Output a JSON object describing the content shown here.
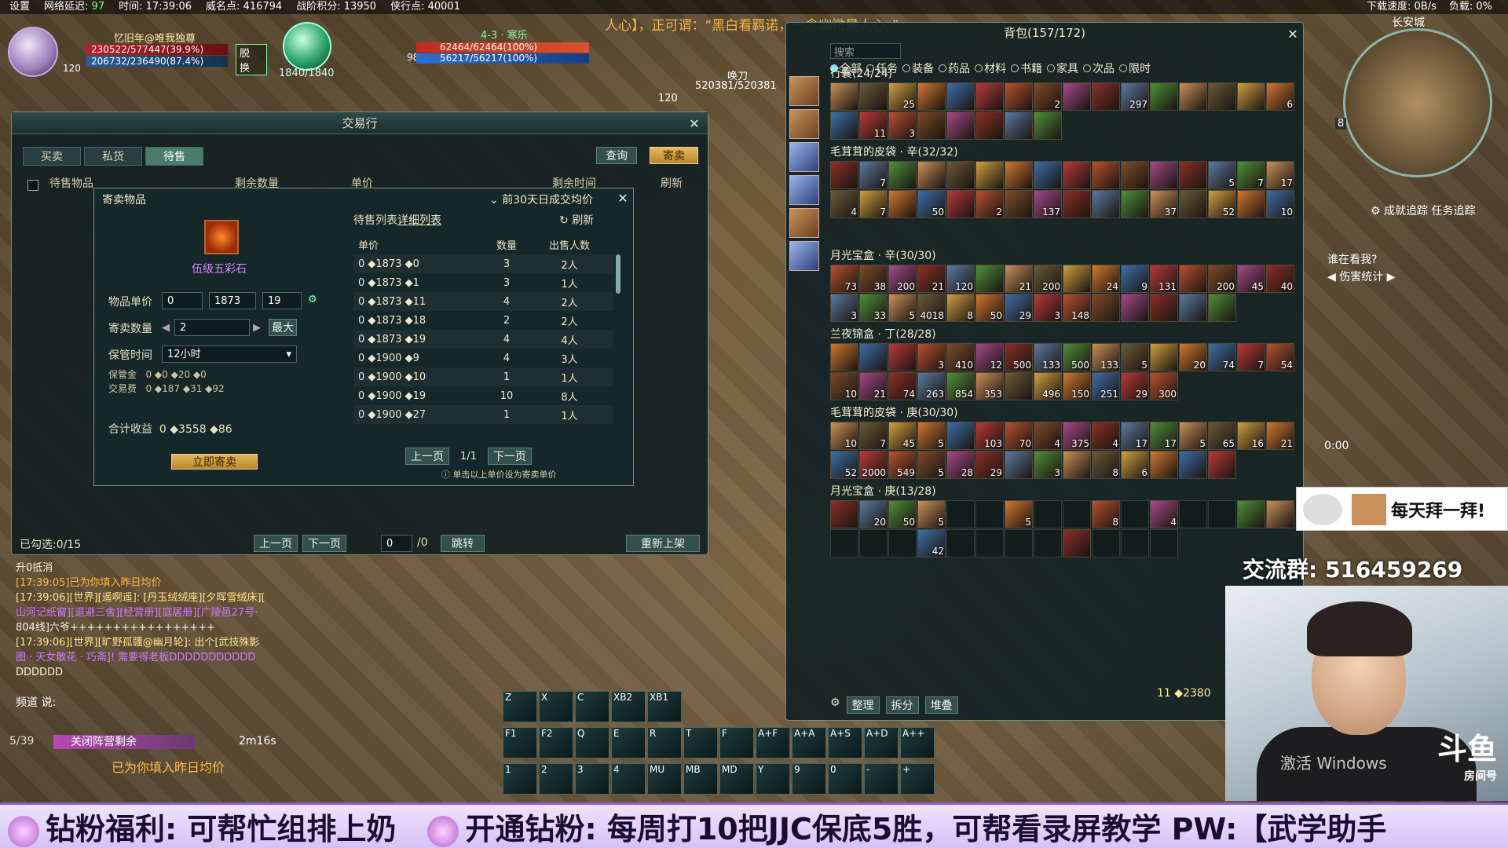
{
  "topbar": {
    "settings": "设置",
    "latency_label": "网络延迟:",
    "latency": "97",
    "time_label": "时间:",
    "time": "17:39:06",
    "fame_label": "威名点:",
    "fame": "416794",
    "war_label": "战阶积分:",
    "war": "13950",
    "merchant_label": "侠行点:",
    "merchant": "40001",
    "download_label": "下载速度:",
    "download": "0B/s",
    "load_label": "负载:",
    "load": "0%"
  },
  "scroll_quote": "人心】，正可谓：“黑白看羁诺，一念幽微是人心。”",
  "player": {
    "name": "忆旧年@唯我独尊",
    "level": "120",
    "hp": "230522/577447(39.9%)",
    "mp": "206732/236490(87.4%)",
    "disengage": "脱 换",
    "orb_value": "1840/1840"
  },
  "target": {
    "name": "4-3 · 寒乐",
    "level": "98",
    "hp": "62464/62464(100%)",
    "mp": "56217/56217(100%)"
  },
  "npc": {
    "name": "唤刀",
    "level": "120",
    "value": "520381/520381"
  },
  "trade": {
    "title": "交易行",
    "tabs": [
      "买卖",
      "私货",
      "待售"
    ],
    "query": "查询",
    "consign": "寄卖",
    "header": {
      "item": "待售物品",
      "remaining": "剩余数量",
      "price": "单价",
      "time_left": "剩余时间",
      "refresh": "刷新"
    },
    "selected": "已勾选:0/15",
    "prev": "上一页",
    "next": "下一页",
    "page_input": "0",
    "page_total": "/0",
    "jump": "跳转",
    "relist": "重新上架"
  },
  "consign": {
    "title": "寄卖物品",
    "avg_link": "前30天日成交均价",
    "item_name": "伍级五彩石",
    "unit_price_label": "物品单价",
    "price_gold": "0",
    "price_silver": "1873",
    "price_copper": "19",
    "qty_label": "寄卖数量",
    "qty": "2",
    "max": "最大",
    "keep_label": "保管时间",
    "keep": "12小时",
    "deposit_label": "保管金",
    "deposit": "0 ◆0 ◆20 ◆0",
    "fee_label": "交易费",
    "fee": "0 ◆187 ◆31 ◆92",
    "total_label": "合计收益",
    "total": "0 ◆3558 ◆86",
    "submit": "立即寄卖",
    "pending_title": "待售列表",
    "pending_link": "详细列表",
    "pending_refresh": "刷新",
    "cols": [
      "单价",
      "数量",
      "出售人数"
    ],
    "rows": [
      {
        "price": "0 ◆1873 ◆0",
        "qty": "3",
        "sellers": "2人"
      },
      {
        "price": "0 ◆1873 ◆1",
        "qty": "3",
        "sellers": "1人"
      },
      {
        "price": "0 ◆1873 ◆11",
        "qty": "4",
        "sellers": "2人"
      },
      {
        "price": "0 ◆1873 ◆18",
        "qty": "2",
        "sellers": "2人"
      },
      {
        "price": "0 ◆1873 ◆19",
        "qty": "4",
        "sellers": "4人"
      },
      {
        "price": "0 ◆1900 ◆9",
        "qty": "4",
        "sellers": "3人"
      },
      {
        "price": "0 ◆1900 ◆10",
        "qty": "1",
        "sellers": "1人"
      },
      {
        "price": "0 ◆1900 ◆19",
        "qty": "10",
        "sellers": "8人"
      },
      {
        "price": "0 ◆1900 ◆27",
        "qty": "1",
        "sellers": "1人"
      }
    ],
    "prev": "上一页",
    "page": "1/1",
    "next": "下一页",
    "hint": "单击以上单价设为寄卖单价"
  },
  "chat": {
    "lines": [
      {
        "cls": "line",
        "text": "升0抵消"
      },
      {
        "cls": "sys",
        "text": "[17:39:05]已为你填入昨日均价"
      },
      {
        "cls": "world",
        "text": "[17:39:06][世界][遥啊遥]: [丹玉绒绒座][夕晖雪绒床]["
      },
      {
        "cls": "link",
        "text": "山河记纸窗][退避三舍][经营册][庭居册][广陵邑27号·"
      },
      {
        "cls": "line",
        "text": "804线]六爷+++++++++++++++++"
      },
      {
        "cls": "world",
        "text": "[17:39:06][世界][旷野孤疆@幽月轮]: 出个[武技殊影"
      },
      {
        "cls": "link",
        "text": "图 · 天女散花 · 巧斋]! 需要得老板DDDDDDDDDDD"
      },
      {
        "cls": "line",
        "text": "DDDDDD"
      }
    ],
    "channel": "频道 说:"
  },
  "camp": {
    "count": "5/39",
    "label": "关闭阵营剩余",
    "time": "2m16s",
    "msg": "已为你填入昨日均价"
  },
  "skills": {
    "row1": [
      "Z",
      "X",
      "C",
      "XB2",
      "XB1"
    ],
    "row2": [
      "F1",
      "F2",
      "Q",
      "E",
      "R",
      "T",
      "F",
      "A+F",
      "A+A",
      "A+S",
      "A+D",
      "A++"
    ],
    "row3": [
      "1",
      "2",
      "3",
      "4",
      "MU",
      "MB",
      "MD",
      "Y",
      "9",
      "0",
      "-",
      "+"
    ]
  },
  "bag": {
    "title": "背包(157/172)",
    "search_placeholder": "搜索",
    "filters": [
      "全部",
      "任务",
      "装备",
      "药品",
      "材料",
      "书籍",
      "家具",
      "次品",
      "限时"
    ],
    "sections": [
      {
        "name": "行囊(24/24)",
        "counts": [
          "",
          "",
          "25",
          "",
          "",
          "",
          "",
          "2",
          "",
          "",
          "297",
          "",
          "",
          "",
          "",
          "6",
          "",
          "11",
          "3",
          "",
          "",
          "",
          "",
          ""
        ]
      },
      {
        "name": "毛茸茸的皮袋 · 辛(32/32)",
        "counts": [
          "",
          "7",
          "",
          "",
          "",
          "",
          "",
          "",
          "",
          "",
          "",
          "",
          "",
          "5",
          "7",
          "17",
          "4",
          "7",
          "",
          "50",
          "",
          "2",
          "",
          "137",
          "",
          "",
          "",
          "37",
          "",
          "52",
          "",
          "10"
        ]
      },
      {
        "name": "月光宝盒 · 辛(30/30)",
        "counts": [
          "73",
          "38",
          "200",
          "21",
          "120",
          "",
          "21",
          "200",
          "",
          "24",
          "9",
          "131",
          "",
          "200",
          "45",
          "40",
          "3",
          "33",
          "5",
          "4018",
          "8",
          "50",
          "29",
          "3",
          "148",
          "",
          "",
          "",
          "",
          ""
        ]
      },
      {
        "name": "兰夜锦盒 · 丁(28/28)",
        "counts": [
          "",
          "",
          "",
          "3",
          "410",
          "12",
          "500",
          "133",
          "500",
          "133",
          "5",
          "",
          "20",
          "74",
          "7",
          "54",
          "10",
          "21",
          "74",
          "263",
          "854",
          "353",
          "",
          "496",
          "150",
          "251",
          "29",
          "300"
        ]
      },
      {
        "name": "毛茸茸的皮袋 · 庚(30/30)",
        "counts": [
          "10",
          "7",
          "45",
          "5",
          "",
          "103",
          "70",
          "4",
          "375",
          "4",
          "17",
          "17",
          "5",
          "65",
          "16",
          "21",
          "52",
          "2000",
          "549",
          "5",
          "28",
          "29",
          "",
          "3",
          "",
          "8",
          "6",
          "",
          "",
          ""
        ]
      },
      {
        "name": "月光宝盒 · 庚(13/28)",
        "counts": [
          "",
          "20",
          "50",
          "5",
          "",
          "",
          "5",
          "",
          "",
          "8",
          "",
          "4",
          "",
          "",
          "",
          "",
          "",
          "",
          "",
          "42",
          "",
          "",
          "",
          "",
          "",
          "",
          "",
          ""
        ]
      }
    ],
    "sort": "整理",
    "split": "拆分",
    "stack": "堆叠",
    "money_count": "11",
    "money": "2380"
  },
  "minimap": {
    "city": "长安城",
    "level": "8"
  },
  "tracking": "成就追踪  任务追踪",
  "watch": "谁在看我?",
  "dmg": "伤害统计",
  "timer": "0:00",
  "overlay": {
    "banner": "每天拜一拜!",
    "group": "交流群: 516459269",
    "win_activate": "激活 Windows",
    "douyu": "斗鱼",
    "room": "房间号"
  },
  "ticker": [
    "钻粉福利: 可帮忙组排上奶",
    "开通钻粉: 每周打10把JJC保底5胜，可帮看录屏教学  PW:【武学助手"
  ],
  "colors": {
    "accent": "#4a7c6c",
    "gold": "#e3b85a",
    "purple_item": "#d58cff"
  }
}
